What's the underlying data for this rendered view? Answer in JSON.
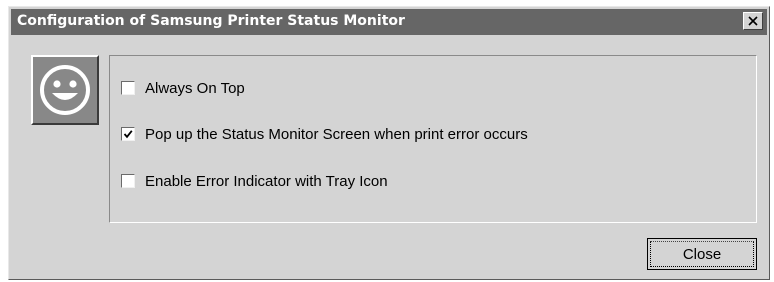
{
  "window": {
    "title": "Configuration of Samsung Printer Status Monitor",
    "close_icon": "close-icon"
  },
  "icon": {
    "name": "smiley-face-icon"
  },
  "options": [
    {
      "label": "Always On Top",
      "checked": false
    },
    {
      "label": "Pop up the Status Monitor Screen when print error occurs",
      "checked": true
    },
    {
      "label": "Enable Error Indicator with Tray Icon",
      "checked": false
    }
  ],
  "buttons": {
    "close_label": "Close"
  },
  "colors": {
    "titlebar": "#666666",
    "dialog_bg": "#d4d4d4",
    "icon_bg": "#888888"
  }
}
